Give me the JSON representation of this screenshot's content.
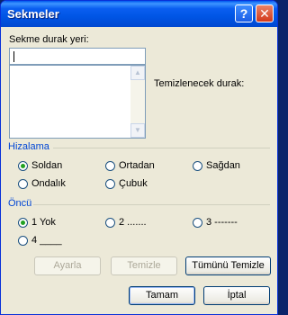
{
  "window": {
    "title": "Sekmeler",
    "help_glyph": "?",
    "close_glyph": "✕"
  },
  "tab_stop": {
    "label": "Sekme durak yeri:",
    "value": "",
    "clear_label": "Temizlenecek durak:",
    "scroll_up_glyph": "▲",
    "scroll_down_glyph": "▼"
  },
  "alignment": {
    "title": "Hizalama",
    "options": [
      {
        "label": "Soldan",
        "checked": true
      },
      {
        "label": "Ortadan",
        "checked": false
      },
      {
        "label": "Sağdan",
        "checked": false
      },
      {
        "label": "Ondalık",
        "checked": false
      },
      {
        "label": "Çubuk",
        "checked": false
      }
    ]
  },
  "leader": {
    "title": "Öncü",
    "options": [
      {
        "label": "1 Yok",
        "checked": true
      },
      {
        "label": "2 .......",
        "checked": false
      },
      {
        "label": "3 -------",
        "checked": false
      },
      {
        "label": "4 ____",
        "checked": false
      }
    ]
  },
  "buttons": {
    "set": "Ayarla",
    "clear": "Temizle",
    "clear_all": "Tümünü Temizle",
    "ok": "Tamam",
    "cancel": "İptal"
  },
  "colors": {
    "accent": "#0046d5",
    "selected_radio": "#21a121",
    "dialog_bg": "#ece9d8"
  }
}
